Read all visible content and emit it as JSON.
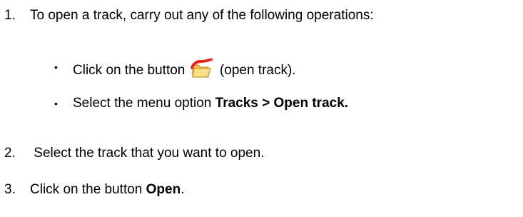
{
  "steps": [
    {
      "number": "1.",
      "text": "To open a track, carry out any of the following operations:",
      "options": [
        {
          "prefix": "Click on the button ",
          "icon": "open-track-folder-icon",
          "suffix": " (open track)."
        },
        {
          "prefix": "Select the menu option ",
          "bold": "Tracks > Open track."
        }
      ]
    },
    {
      "number": "2.",
      "text": " Select the track that you want to open."
    },
    {
      "number": "3.",
      "prefix": "Click on the button ",
      "bold": "Open",
      "suffix": "."
    }
  ],
  "bullet_char": "•",
  "colors": {
    "text": "#000000",
    "icon_red": "#e8231b",
    "icon_folder": "#f2c84b"
  }
}
